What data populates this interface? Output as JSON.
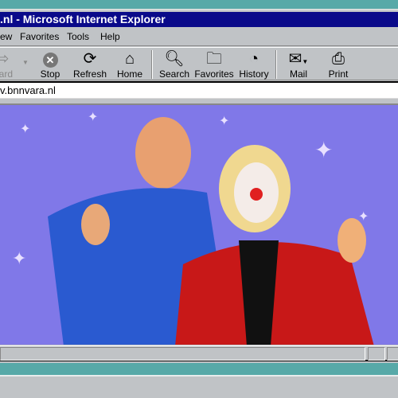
{
  "window": {
    "title": ".nl - Microsoft Internet Explorer"
  },
  "menu": [
    "ew",
    "Favorites",
    "Tools",
    "Help"
  ],
  "toolbar": [
    {
      "label": "ward",
      "icon": "forward-arrow-icon",
      "disabled": true
    },
    {
      "label": "Stop",
      "icon": "stop-icon"
    },
    {
      "label": "Refresh",
      "icon": "refresh-icon"
    },
    {
      "label": "Home",
      "icon": "home-icon"
    },
    {
      "label": "Search",
      "icon": "search-icon"
    },
    {
      "label": "Favorites",
      "icon": "favorites-icon"
    },
    {
      "label": "History",
      "icon": "history-icon"
    },
    {
      "label": "Mail",
      "icon": "mail-icon"
    },
    {
      "label": "Print",
      "icon": "print-icon"
    }
  ],
  "address": {
    "value": "v.bnnvara.nl"
  },
  "content": {
    "image": "two men giving thumbs up, one dressed as a clown, on purple sparkly background"
  }
}
